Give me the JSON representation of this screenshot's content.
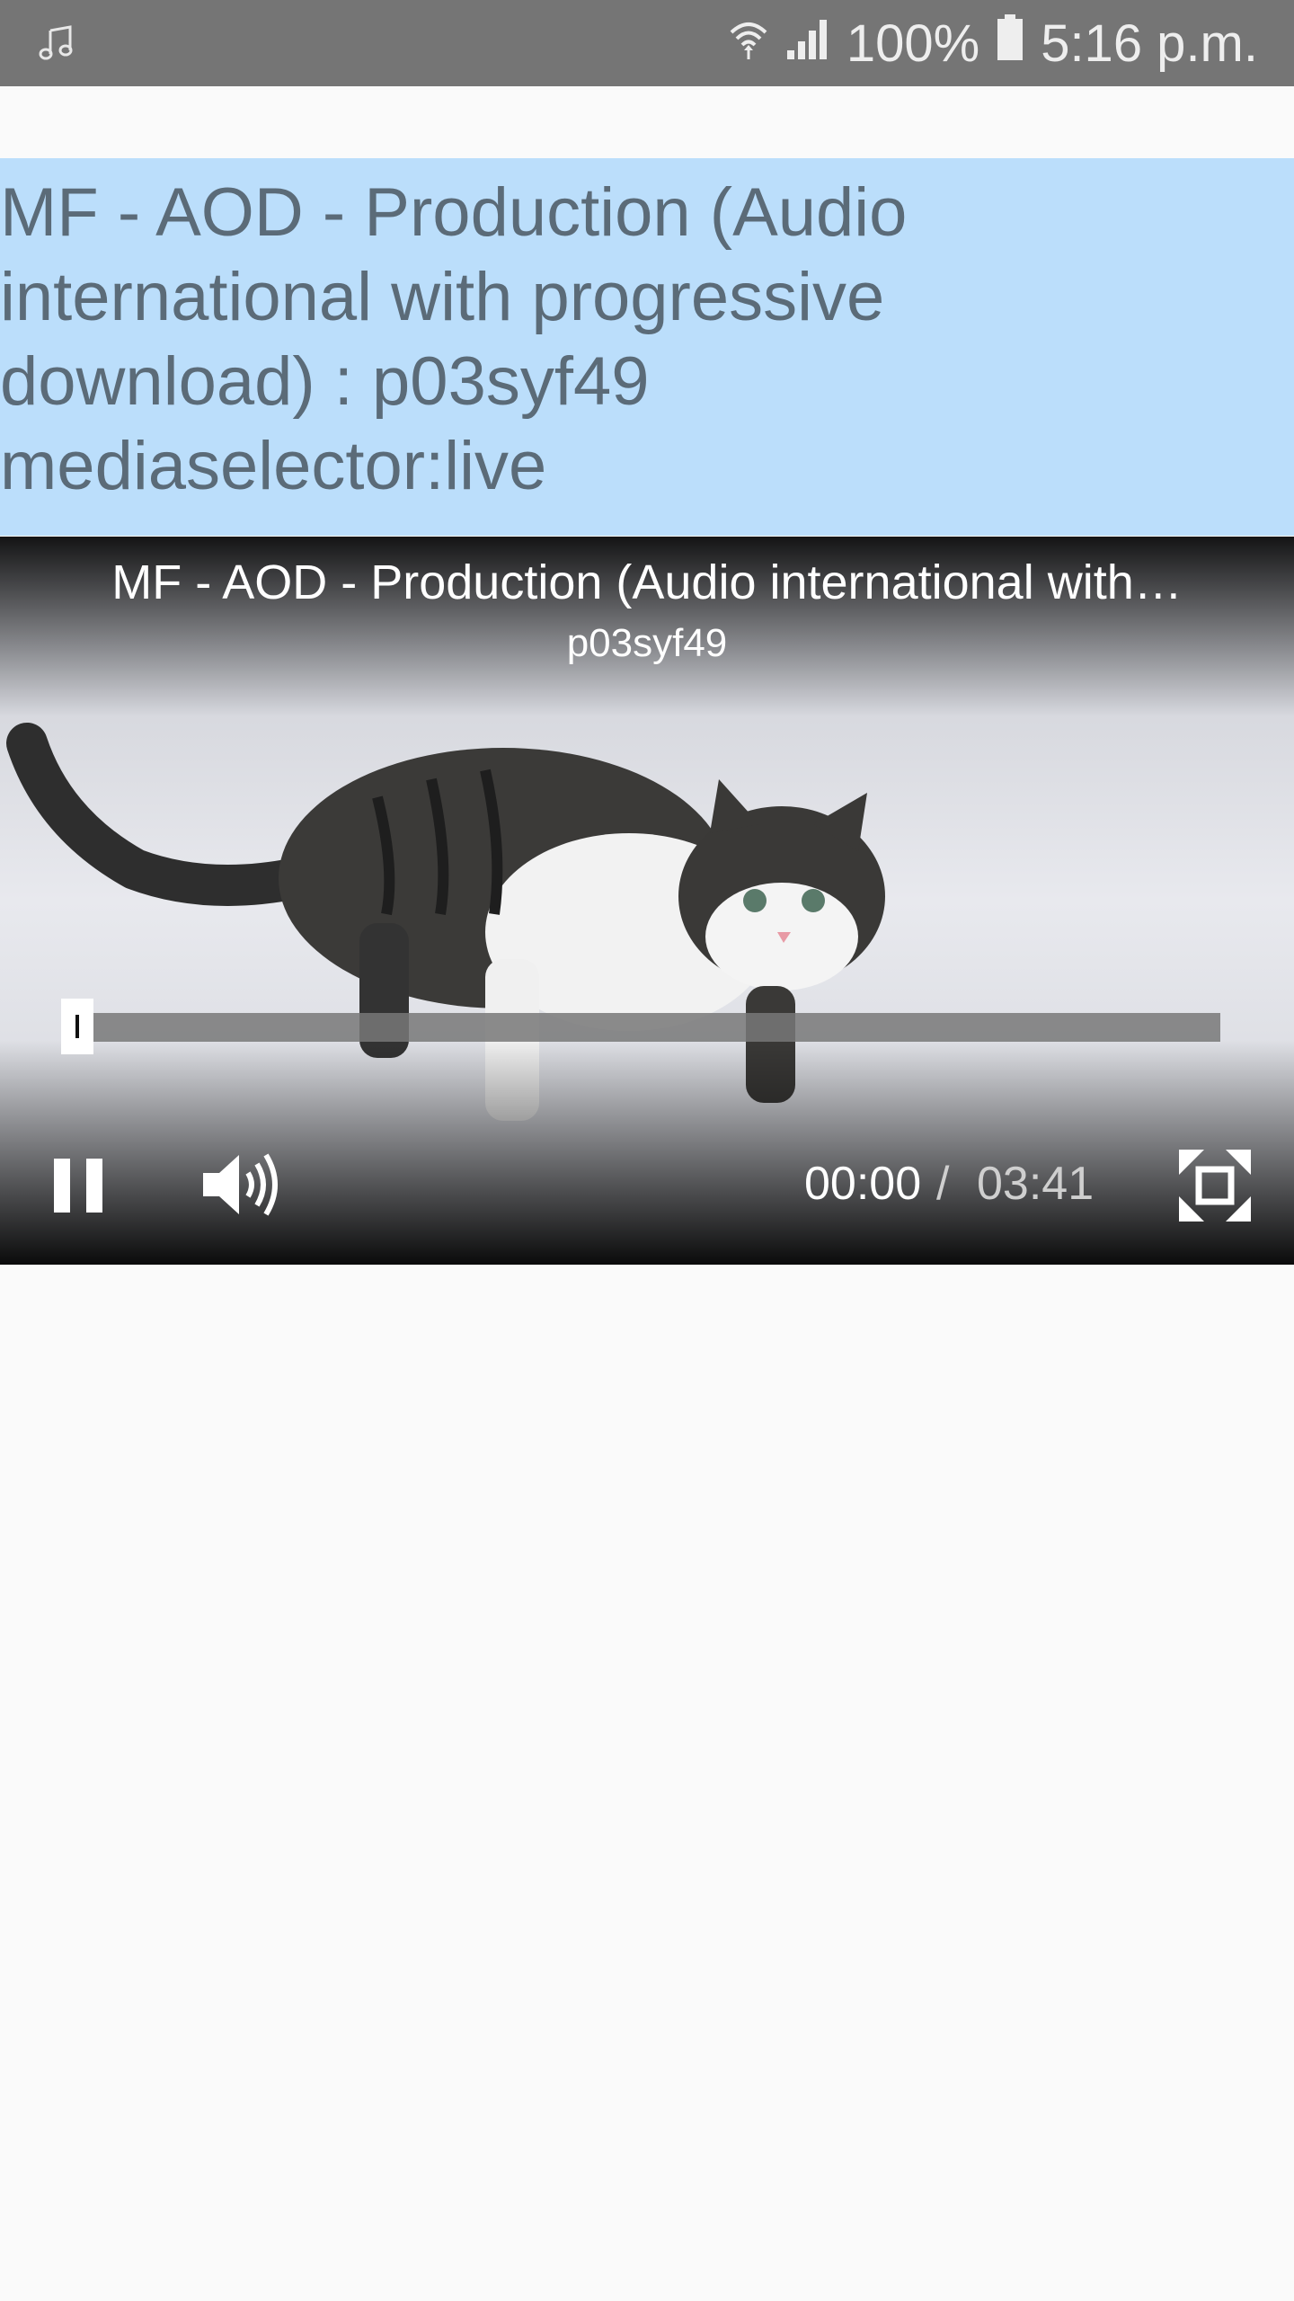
{
  "status_bar": {
    "notification_icon": "music-note-icon",
    "wifi_icon": "wifi-icon",
    "signal_icon": "signal-icon",
    "battery": "100%",
    "battery_icon": "battery-icon",
    "time": "5:16 p.m."
  },
  "header": {
    "line1": "MF - AOD - Production (Audio",
    "line2": "international with progressive",
    "line3": "download) : p03syf49",
    "line4": "mediaselector:live"
  },
  "player": {
    "title": "MF - AOD - Production (Audio international with…",
    "subtitle": "p03syf49",
    "progress_fraction": 0.0,
    "current_time": "00:00",
    "separator": "/",
    "total_time": "03:41",
    "pause_icon": "pause-icon",
    "volume_icon": "volume-icon",
    "fullscreen_icon": "fullscreen-icon"
  }
}
